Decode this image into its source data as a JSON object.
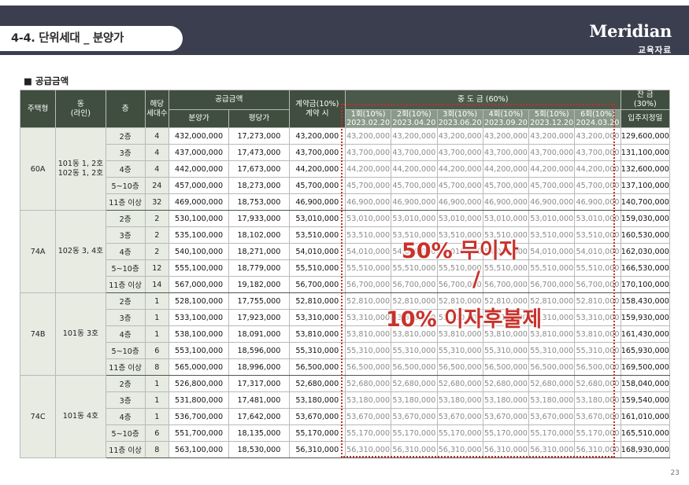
{
  "header": {
    "title": "4-4. 단위세대 _ 분양가",
    "brand_logo": "Meridian",
    "brand_sub": "교육자료"
  },
  "section_label": "■ 공급금액",
  "table": {
    "headers": {
      "type": "주택형",
      "dong": "동\n(라인)",
      "floor": "층",
      "units": "해당\n세대수",
      "supply": "공급금액",
      "sale_price": "분양가",
      "per_pyeong": "평당가",
      "contract": "계약금(10%)\n계약 시",
      "middle": "중 도 금 (60%)",
      "balance": "잔 금\n(30%)",
      "balance_sub": "입주지정일"
    },
    "installments": [
      {
        "label": "1회(10%)",
        "date": "2023.02.20"
      },
      {
        "label": "2회(10%)",
        "date": "2023.04.20"
      },
      {
        "label": "3회(10%)",
        "date": "2023.06.20"
      },
      {
        "label": "4회(10%)",
        "date": "2023.09.20"
      },
      {
        "label": "5회(10%)",
        "date": "2023.12.20"
      },
      {
        "label": "6회(10%)",
        "date": "2024.03.20"
      }
    ],
    "groups": [
      {
        "type": "60A",
        "dong": "101동 1, 2호\n102동 1, 2호",
        "rows": [
          {
            "floor": "2층",
            "units": "4",
            "price": "432,000,000",
            "per": "17,273,000",
            "contract": "43,200,000",
            "middle": "43,200,000",
            "balance": "129,600,000"
          },
          {
            "floor": "3층",
            "units": "4",
            "price": "437,000,000",
            "per": "17,473,000",
            "contract": "43,700,000",
            "middle": "43,700,000",
            "balance": "131,100,000"
          },
          {
            "floor": "4층",
            "units": "4",
            "price": "442,000,000",
            "per": "17,673,000",
            "contract": "44,200,000",
            "middle": "44,200,000",
            "balance": "132,600,000"
          },
          {
            "floor": "5~10층",
            "units": "24",
            "price": "457,000,000",
            "per": "18,273,000",
            "contract": "45,700,000",
            "middle": "45,700,000",
            "balance": "137,100,000"
          },
          {
            "floor": "11층 이상",
            "units": "32",
            "price": "469,000,000",
            "per": "18,753,000",
            "contract": "46,900,000",
            "middle": "46,900,000",
            "balance": "140,700,000"
          }
        ]
      },
      {
        "type": "74A",
        "dong": "102동 3, 4호",
        "rows": [
          {
            "floor": "2층",
            "units": "2",
            "price": "530,100,000",
            "per": "17,933,000",
            "contract": "53,010,000",
            "middle": "53,010,000",
            "balance": "159,030,000"
          },
          {
            "floor": "3층",
            "units": "2",
            "price": "535,100,000",
            "per": "18,102,000",
            "contract": "53,510,000",
            "middle": "53,510,000",
            "balance": "160,530,000"
          },
          {
            "floor": "4층",
            "units": "2",
            "price": "540,100,000",
            "per": "18,271,000",
            "contract": "54,010,000",
            "middle": "54,010,000",
            "balance": "162,030,000"
          },
          {
            "floor": "5~10층",
            "units": "12",
            "price": "555,100,000",
            "per": "18,779,000",
            "contract": "55,510,000",
            "middle": "55,510,000",
            "balance": "166,530,000"
          },
          {
            "floor": "11층 이상",
            "units": "14",
            "price": "567,000,000",
            "per": "19,182,000",
            "contract": "56,700,000",
            "middle": "56,700,000",
            "balance": "170,100,000"
          }
        ]
      },
      {
        "type": "74B",
        "dong": "101동 3호",
        "rows": [
          {
            "floor": "2층",
            "units": "1",
            "price": "528,100,000",
            "per": "17,755,000",
            "contract": "52,810,000",
            "middle": "52,810,000",
            "balance": "158,430,000"
          },
          {
            "floor": "3층",
            "units": "1",
            "price": "533,100,000",
            "per": "17,923,000",
            "contract": "53,310,000",
            "middle": "53,310,000",
            "balance": "159,930,000"
          },
          {
            "floor": "4층",
            "units": "1",
            "price": "538,100,000",
            "per": "18,091,000",
            "contract": "53,810,000",
            "middle": "53,810,000",
            "balance": "161,430,000"
          },
          {
            "floor": "5~10층",
            "units": "6",
            "price": "553,100,000",
            "per": "18,596,000",
            "contract": "55,310,000",
            "middle": "55,310,000",
            "balance": "165,930,000"
          },
          {
            "floor": "11층 이상",
            "units": "8",
            "price": "565,000,000",
            "per": "18,996,000",
            "contract": "56,500,000",
            "middle": "56,500,000",
            "balance": "169,500,000"
          }
        ]
      },
      {
        "type": "74C",
        "dong": "101동 4호",
        "rows": [
          {
            "floor": "2층",
            "units": "1",
            "price": "526,800,000",
            "per": "17,317,000",
            "contract": "52,680,000",
            "middle": "52,680,000",
            "balance": "158,040,000"
          },
          {
            "floor": "3층",
            "units": "1",
            "price": "531,800,000",
            "per": "17,481,000",
            "contract": "53,180,000",
            "middle": "53,180,000",
            "balance": "159,540,000"
          },
          {
            "floor": "4층",
            "units": "1",
            "price": "536,700,000",
            "per": "17,642,000",
            "contract": "53,670,000",
            "middle": "53,670,000",
            "balance": "161,010,000"
          },
          {
            "floor": "5~10층",
            "units": "6",
            "price": "551,700,000",
            "per": "18,135,000",
            "contract": "55,170,000",
            "middle": "55,170,000",
            "balance": "165,510,000"
          },
          {
            "floor": "11층 이상",
            "units": "8",
            "price": "563,100,000",
            "per": "18,530,000",
            "contract": "56,310,000",
            "middle": "56,310,000",
            "balance": "168,930,000"
          }
        ]
      }
    ]
  },
  "overlay": {
    "line1": "50% 무이자",
    "line2": "/",
    "line3": "10% 이자후불제"
  },
  "page_number": "23",
  "colors": {
    "topbar": "#3b3e4f",
    "header_green": "#3f4e3f",
    "middle_header": "#8a9a8a",
    "group_cell": "#e7ebe2",
    "highlight_red": "#c8322b"
  }
}
